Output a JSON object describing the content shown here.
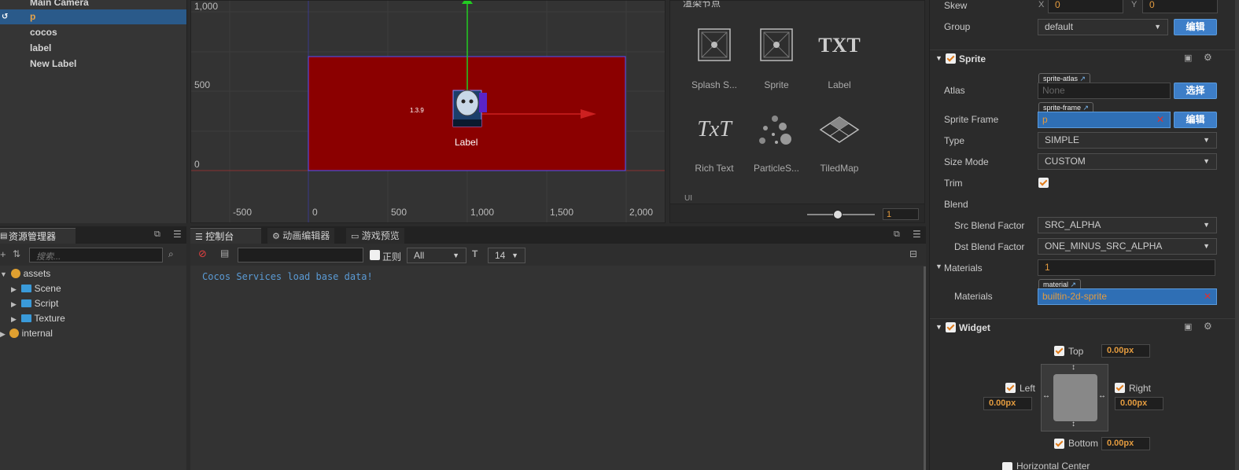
{
  "hierarchy": {
    "items": [
      "Main Camera",
      "p",
      "cocos",
      "label",
      "New Label"
    ],
    "selected_index": 1
  },
  "scene": {
    "y_ticks": [
      "1,000",
      "500",
      "0"
    ],
    "x_ticks": [
      "-500",
      "0",
      "500",
      "1,000",
      "1,500",
      "2,000"
    ],
    "node_version": "1.3.9",
    "node_label": "Label",
    "rect_color": "#8b0000"
  },
  "node_library": {
    "header": "渲染节点",
    "tiles": [
      "Splash S...",
      "Sprite",
      "Label",
      "Rich Text",
      "ParticleS...",
      "TiledMap"
    ],
    "txt_glyph": "TXT",
    "rich_glyph": "TxT",
    "partial": "UI",
    "zoom_value": "1"
  },
  "assets_panel": {
    "tab_label": "资源管理器",
    "search_placeholder": "搜索...",
    "tree": [
      {
        "label": "assets",
        "type": "db",
        "level": 0,
        "expanded": true
      },
      {
        "label": "Scene",
        "type": "folder",
        "level": 1,
        "expanded": false
      },
      {
        "label": "Script",
        "type": "folder",
        "level": 1,
        "expanded": false
      },
      {
        "label": "Texture",
        "type": "folder",
        "level": 1,
        "expanded": false
      },
      {
        "label": "internal",
        "type": "db",
        "level": 0,
        "expanded": false
      }
    ]
  },
  "console_panel": {
    "tabs": [
      "控制台",
      "动画编辑器",
      "游戏预览"
    ],
    "regex_label": "正则",
    "level_filter": "All",
    "font_size": "14",
    "log": "Cocos Services load base data!"
  },
  "inspector": {
    "skew": {
      "label": "Skew",
      "x_label": "X",
      "x": "0",
      "y_label": "Y",
      "y": "0"
    },
    "group": {
      "label": "Group",
      "value": "default",
      "button": "编辑"
    },
    "sprite": {
      "title": "Sprite",
      "atlas_label": "Atlas",
      "atlas_tag": "sprite-atlas",
      "atlas_value": "None",
      "atlas_button": "选择",
      "frame_label": "Sprite Frame",
      "frame_tag": "sprite-frame",
      "frame_value": "p",
      "frame_button": "编辑",
      "type_label": "Type",
      "type_value": "SIMPLE",
      "size_mode_label": "Size Mode",
      "size_mode_value": "CUSTOM",
      "trim_label": "Trim",
      "blend_label": "Blend",
      "src_label": "Src Blend Factor",
      "src_value": "SRC_ALPHA",
      "dst_label": "Dst Blend Factor",
      "dst_value": "ONE_MINUS_SRC_ALPHA",
      "materials_label": "Materials",
      "materials_count": "1",
      "material_item_label": "Materials",
      "material_tag": "material",
      "material_value": "builtin-2d-sprite"
    },
    "widget": {
      "title": "Widget",
      "top_label": "Top",
      "top_value": "0.00px",
      "left_label": "Left",
      "left_value": "0.00px",
      "right_label": "Right",
      "right_value": "0.00px",
      "bottom_label": "Bottom",
      "bottom_value": "0.00px",
      "partial": "Horizontal Center"
    }
  },
  "colors": {
    "accent_blue": "#3d7ec8",
    "selection": "#2a5a8a",
    "value_orange": "#e39b3f",
    "log_blue": "#5b9bd5"
  }
}
